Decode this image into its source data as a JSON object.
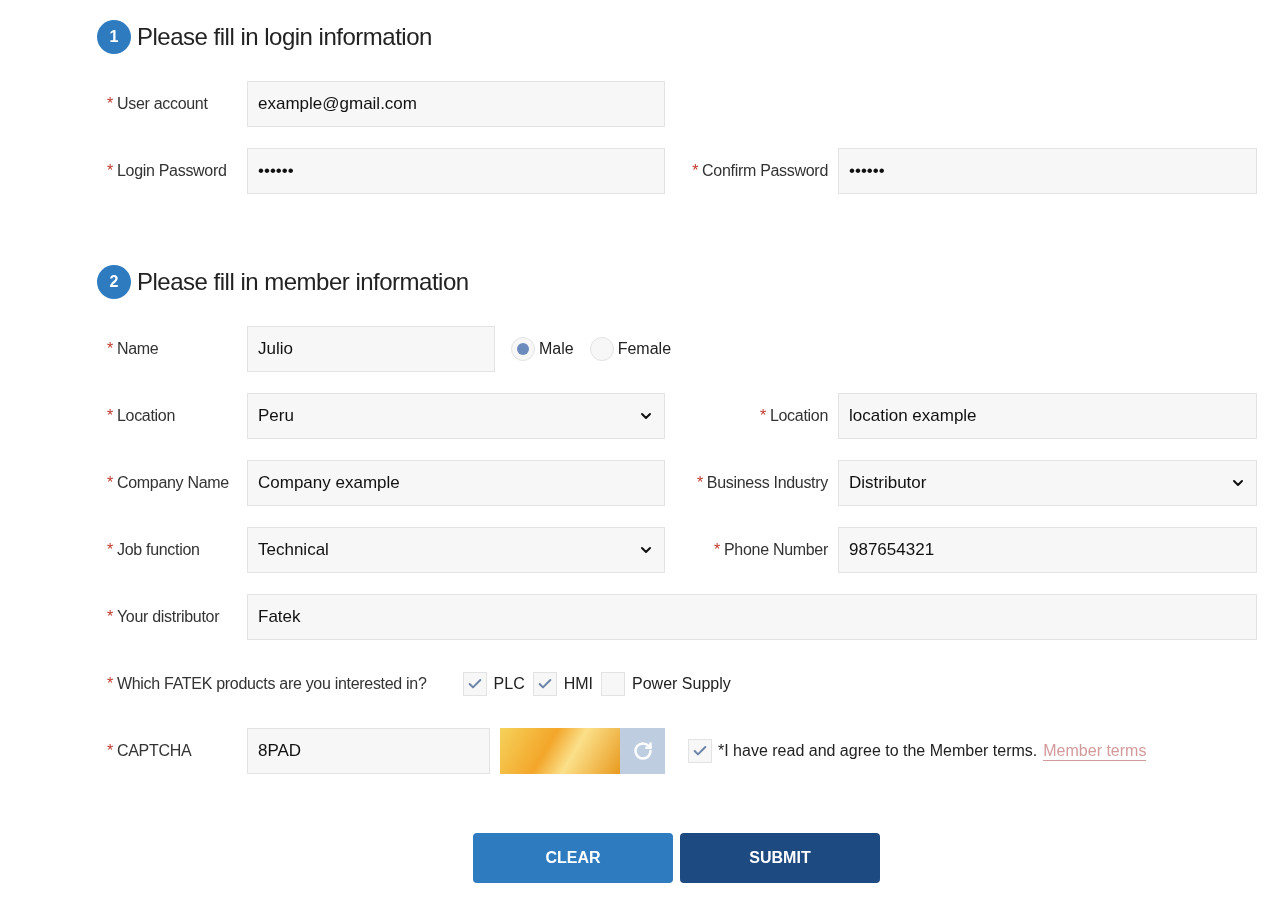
{
  "required_mark": "*",
  "sections": [
    {
      "number": "1",
      "title": "Please fill in login information",
      "rows": [
        [
          {
            "kind": "text",
            "label": "User account",
            "value": "example@gmail.com",
            "required": true
          }
        ],
        [
          {
            "kind": "text",
            "label": "Login Password",
            "value": "••••••",
            "required": true
          },
          {
            "kind": "text",
            "label": "Confirm Password",
            "value": "••••••",
            "required": true
          }
        ]
      ]
    },
    {
      "number": "2",
      "title": "Please fill in member information",
      "rows": [
        [
          {
            "kind": "text",
            "label": "Name",
            "value": "Julio",
            "required": true
          },
          {
            "kind": "radio",
            "options": [
              {
                "label": "Male",
                "selected": true
              },
              {
                "label": "Female",
                "selected": false
              }
            ]
          }
        ],
        [
          {
            "kind": "select",
            "label": "Location",
            "value": "Peru",
            "required": true
          },
          {
            "kind": "text",
            "label": "Location",
            "value": "location example",
            "required": true
          }
        ],
        [
          {
            "kind": "text",
            "label": "Company Name",
            "value": "Company example",
            "required": true
          },
          {
            "kind": "select",
            "label": "Business Industry",
            "value": "Distributor",
            "required": true
          }
        ],
        [
          {
            "kind": "select",
            "label": "Job function",
            "value": "Technical",
            "required": true
          },
          {
            "kind": "text",
            "label": "Phone Number",
            "value": "987654321",
            "required": true
          }
        ],
        [
          {
            "kind": "wide_text",
            "label": "Your distributor",
            "value": "Fatek",
            "required": true
          }
        ],
        [
          {
            "kind": "checkboxes",
            "label": "Which FATEK products are you interested in?",
            "required": true,
            "options": [
              {
                "label": "PLC",
                "checked": true
              },
              {
                "label": "HMI",
                "checked": true
              },
              {
                "label": "Power Supply",
                "checked": false
              }
            ]
          }
        ],
        [
          {
            "kind": "captcha",
            "label": "CAPTCHA",
            "value": "8PAD",
            "required": true
          },
          {
            "kind": "terms",
            "checked": true,
            "text": "*I have read and agree to the Member terms.",
            "link": "Member terms"
          }
        ]
      ]
    }
  ],
  "buttons": [
    {
      "label": "CLEAR",
      "kind": "secondary"
    },
    {
      "label": "SUBMIT",
      "kind": "primary"
    }
  ]
}
